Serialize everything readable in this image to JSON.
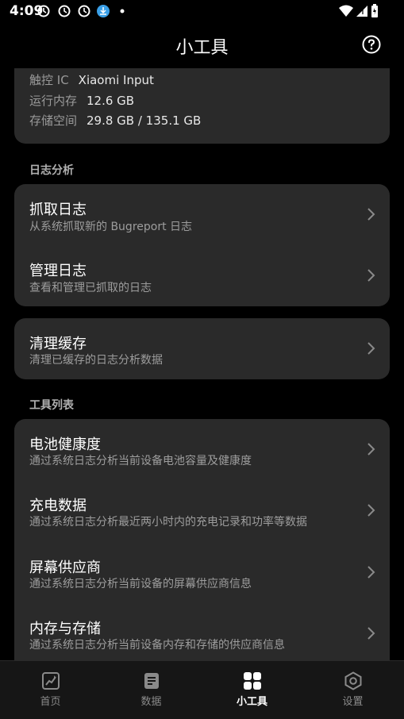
{
  "status_bar": {
    "time": "4:09"
  },
  "app_bar": {
    "title": "小工具"
  },
  "device_info": [
    {
      "label": "触控 IC",
      "value": "Xiaomi Input"
    },
    {
      "label": "运行内存",
      "value": "12.6 GB"
    },
    {
      "label": "存储空间",
      "value": "29.8 GB / 135.1 GB"
    }
  ],
  "log_section": {
    "header": "日志分析",
    "items": [
      {
        "title": "抓取日志",
        "subtitle": "从系统抓取新的 Bugreport 日志"
      },
      {
        "title": "管理日志",
        "subtitle": "查看和管理已抓取的日志"
      }
    ]
  },
  "cache_card": {
    "title": "清理缓存",
    "subtitle": "清理已缓存的日志分析数据"
  },
  "tools_section": {
    "header": "工具列表",
    "items": [
      {
        "title": "电池健康度",
        "subtitle": "通过系统日志分析当前设备电池容量及健康度"
      },
      {
        "title": "充电数据",
        "subtitle": "通过系统日志分析最近两小时内的充电记录和功率等数据"
      },
      {
        "title": "屏幕供应商",
        "subtitle": "通过系统日志分析当前设备的屏幕供应商信息"
      },
      {
        "title": "内存与存储",
        "subtitle": "通过系统日志分析当前设备内存和存储的供应商信息"
      }
    ]
  },
  "bottom_nav": [
    {
      "label": "首页",
      "icon": "home-chart-icon"
    },
    {
      "label": "数据",
      "icon": "document-icon"
    },
    {
      "label": "小工具",
      "icon": "grid-icon",
      "active": true
    },
    {
      "label": "设置",
      "icon": "hexagon-settings-icon"
    }
  ]
}
